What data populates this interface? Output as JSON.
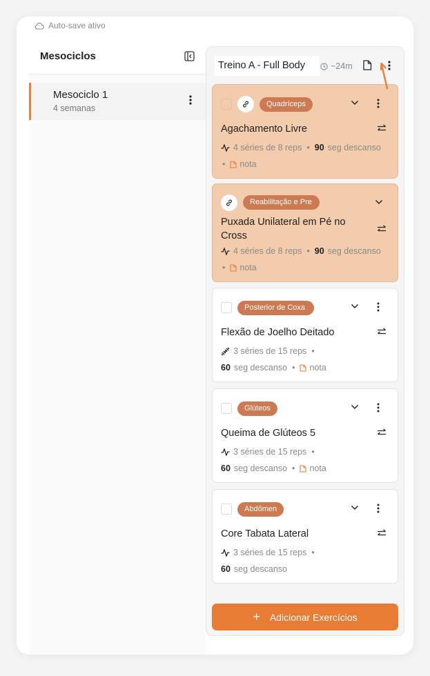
{
  "app": {
    "autosave_label": "Auto-save ativo"
  },
  "sidebar": {
    "title": "Mesociclos",
    "items": [
      {
        "name": "Mesociclo 1",
        "subtitle": "4 semanas"
      }
    ]
  },
  "workout": {
    "title": "Treino A - Full Body",
    "duration": "~24m"
  },
  "exercises": [
    {
      "tag": "Quadríceps",
      "name": "Agachamento Livre",
      "sets": "4 séries de 8 reps",
      "rest_value": "90",
      "rest_label": "seg descanso",
      "note": "nota"
    },
    {
      "tag": "Reabilitação e Pre",
      "name_line1": "Puxada Unilateral em Pé no",
      "name_line2": "Cross",
      "sets": "4 séries de 8 reps",
      "rest_value": "90",
      "rest_label": "seg descanso",
      "note": "nota"
    },
    {
      "tag": "Posterior de Coxa",
      "name": "Flexão de Joelho Deitado",
      "sets": "3 séries de 15 reps",
      "rest_value": "60",
      "rest_label": "seg descanso",
      "note": "nota"
    },
    {
      "tag": "Glúteos",
      "name": "Queima de Glúteos 5",
      "sets": "3 séries de 15 reps",
      "rest_value": "60",
      "rest_label": "seg descanso",
      "note": "nota"
    },
    {
      "tag": "Abdômen",
      "name": "Core Tabata Lateral",
      "sets": "3 séries de 15 reps",
      "rest_value": "60",
      "rest_label": "seg descanso"
    }
  ],
  "actions": {
    "add_exercises": "Adicionar Exercícios",
    "add_icon": "+"
  },
  "colors": {
    "accent": "#e87c34",
    "tag": "#cd7a52",
    "highlight": "#f2ccad"
  }
}
